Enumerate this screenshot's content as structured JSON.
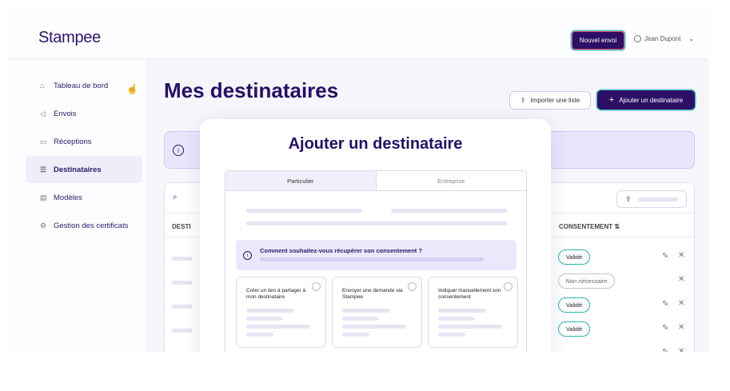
{
  "app": {
    "logo": "Stampee"
  },
  "header": {
    "new_button": "Nouvel envoi",
    "user_name": "Jean Dupont"
  },
  "sidebar": {
    "items": [
      {
        "label": "Tableau de bord",
        "icon": "home-icon"
      },
      {
        "label": "Envois",
        "icon": "send-icon"
      },
      {
        "label": "Réceptions",
        "icon": "inbox-icon"
      },
      {
        "label": "Destinataires",
        "icon": "list-icon",
        "active": true
      },
      {
        "label": "Modèles",
        "icon": "file-icon"
      },
      {
        "label": "Gestion des certificats",
        "icon": "gear-icon"
      }
    ]
  },
  "main": {
    "title": "Mes destinataires",
    "import_button": "Importer une liste",
    "add_button": "Ajouter un destinataire"
  },
  "table": {
    "col_left": "DESTI",
    "col_consent": "CONSENTEMENT",
    "rows": [
      {
        "consent": "Validé",
        "editable": true
      },
      {
        "consent": "Non nécessaire",
        "editable": false
      },
      {
        "consent": "Validé",
        "editable": true
      },
      {
        "consent": "Validé",
        "editable": true
      },
      {
        "consent": "-",
        "editable": true
      }
    ]
  },
  "modal": {
    "title": "Ajouter un destinataire",
    "tabs": [
      "Particulier",
      "Entreprise"
    ],
    "question": "Comment souhaitez-vous récupérer son consentement ?",
    "options": [
      "Créer un lien à partager à mon destinataire",
      "Envoyer une demande via Stampee",
      "Indiquer manuellement son consentement"
    ]
  },
  "colors": {
    "brand": "#2d0f66",
    "accent_teal": "#4fc2c7",
    "accent_red": "#e14d6f",
    "valid_green": "#27b6a6"
  }
}
